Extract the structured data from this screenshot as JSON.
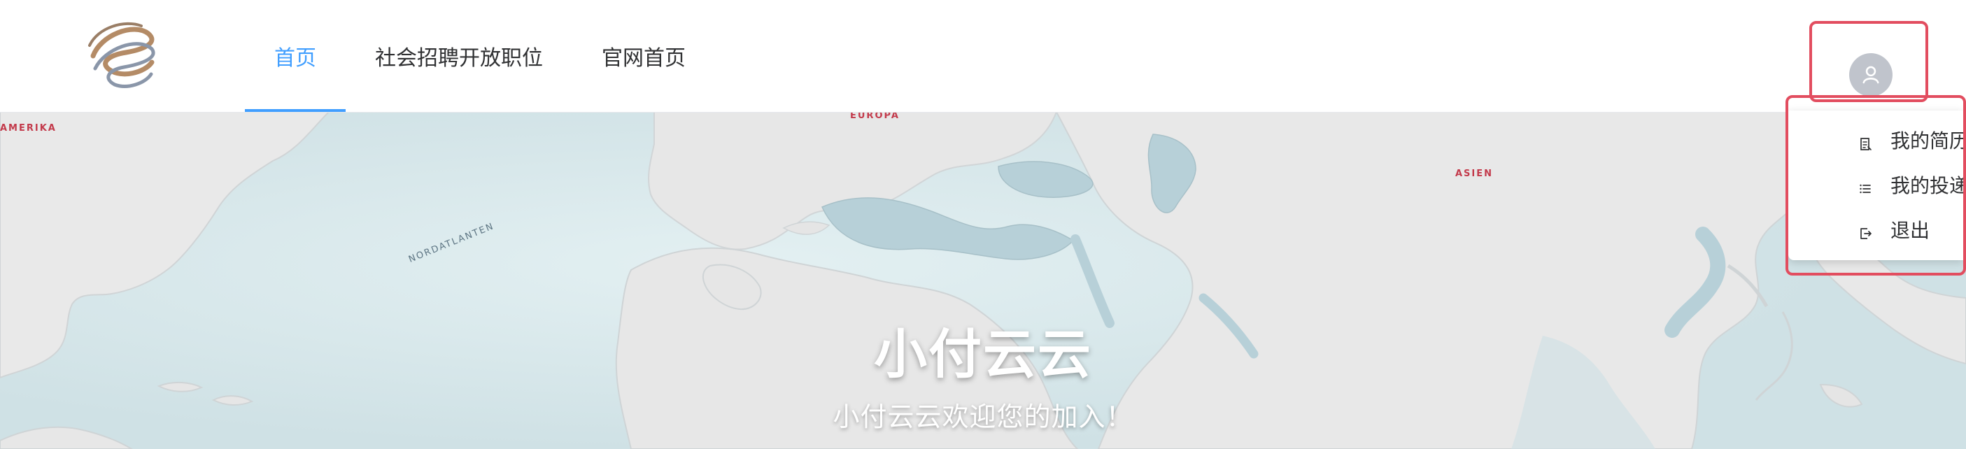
{
  "header": {
    "logo_icon": "company-logo-icon",
    "nav": [
      {
        "label": "首页",
        "active": true
      },
      {
        "label": "社会招聘开放职位",
        "active": false
      },
      {
        "label": "官网首页",
        "active": false
      }
    ],
    "avatar_icon": "user-avatar-icon"
  },
  "map": {
    "labels": {
      "america": "AMERIKA",
      "europa": "EUROPA",
      "asien": "ASIEN",
      "nordatlanten": "NORDATLANTEN"
    },
    "colors": {
      "ocean": "#dbeaed",
      "land": "#e8e8e8",
      "water": "#b9d2d9"
    }
  },
  "hero": {
    "title": "小付云云",
    "subtitle": "小付云云欢迎您的加入！"
  },
  "user_menu": {
    "items": [
      {
        "label": "我的简历",
        "icon": "resume-icon"
      },
      {
        "label": "我的投递",
        "icon": "list-icon"
      },
      {
        "label": "退出",
        "icon": "logout-icon"
      }
    ]
  },
  "colors": {
    "accent": "#409eff",
    "highlight_border": "#e24d5f",
    "avatar_bg": "#c0c4cc",
    "text": "#303133"
  }
}
